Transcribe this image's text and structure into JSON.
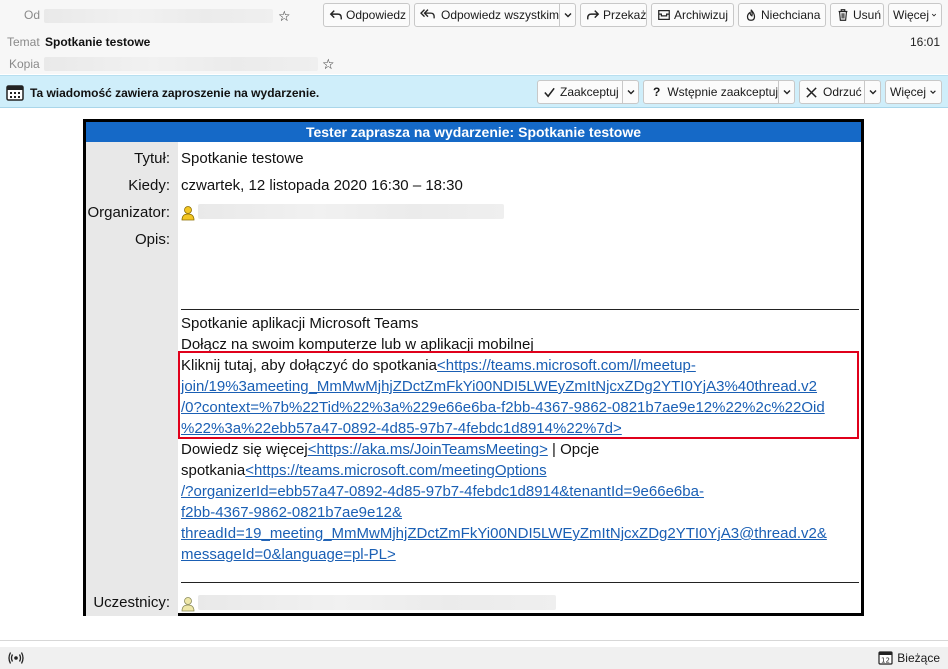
{
  "header": {
    "from_label": "Od",
    "subject_label": "Temat",
    "subject": "Spotkanie testowe",
    "cc_label": "Kopia",
    "time": "16:01",
    "toolbar": {
      "reply": "Odpowiedz",
      "reply_all": "Odpowiedz wszystkim",
      "forward": "Przekaż",
      "archive": "Archiwizuj",
      "junk": "Niechciana",
      "delete": "Usuń",
      "more": "Więcej"
    }
  },
  "notice": {
    "message": "Ta wiadomość zawiera zaproszenie na wydarzenie.",
    "accept": "Zaakceptuj",
    "tentative": "Wstępnie zaakceptuj",
    "decline": "Odrzuć",
    "more": "Więcej"
  },
  "invite": {
    "title": "Tester zaprasza na wydarzenie: Spotkanie testowe",
    "labels": {
      "title": "Tytuł:",
      "when": "Kiedy:",
      "organizer": "Organizator:",
      "description": "Opis:",
      "attendees": "Uczestnicy:"
    },
    "event_title": "Spotkanie testowe",
    "when": "czwartek, 12 listopada 2020 16:30 – 18:30",
    "teams_heading": "Spotkanie aplikacji Microsoft Teams",
    "teams_sub": "Dołącz na swoim komputerze lub w aplikacji mobilnej",
    "join_text": "Kliknij tutaj, aby dołączyć do spotkania",
    "join_link_1": "<https://teams.microsoft.com/l/meetup-",
    "join_link_2": "join/19%3ameeting_MmMwMjhjZDctZmFkYi00NDI5LWEyZmItNjcxZDg2YTI0YjA3%40thread.v2",
    "join_link_3": "/0?context=%7b%22Tid%22%3a%229e66e6ba-f2bb-4367-9862-0821b7ae9e12%22%2c%22Oid",
    "join_link_4": "%22%3a%22ebb57a47-0892-4d85-97b7-4febdc1d8914%22%7d>",
    "learn_more": "Dowiedz się więcej",
    "learn_link": "<https://aka.ms/JoinTeamsMeeting>",
    "options_sep": " | Opcje",
    "options_text": "spotkania",
    "options_link_1": "<https://teams.microsoft.com/meetingOptions",
    "options_link_2": "/?organizerId=ebb57a47-0892-4d85-97b7-4febdc1d8914&tenantId=9e66e6ba-",
    "options_link_3": "f2bb-4367-9862-0821b7ae9e12&",
    "options_link_4": "threadId=19_meeting_MmMwMjhjZDctZmFkYi00NDI5LWEyZmItNjcxZDg2YTI0YjA3@thread.v2&",
    "options_link_5": "messageId=0&language=pl-PL>"
  },
  "status": {
    "today": "Bieżące"
  },
  "colors": {
    "title_bar": "#1569c7",
    "notice_bg": "#cfeefa",
    "link": "#1a5fb4",
    "highlight_box": "#e0001b"
  }
}
